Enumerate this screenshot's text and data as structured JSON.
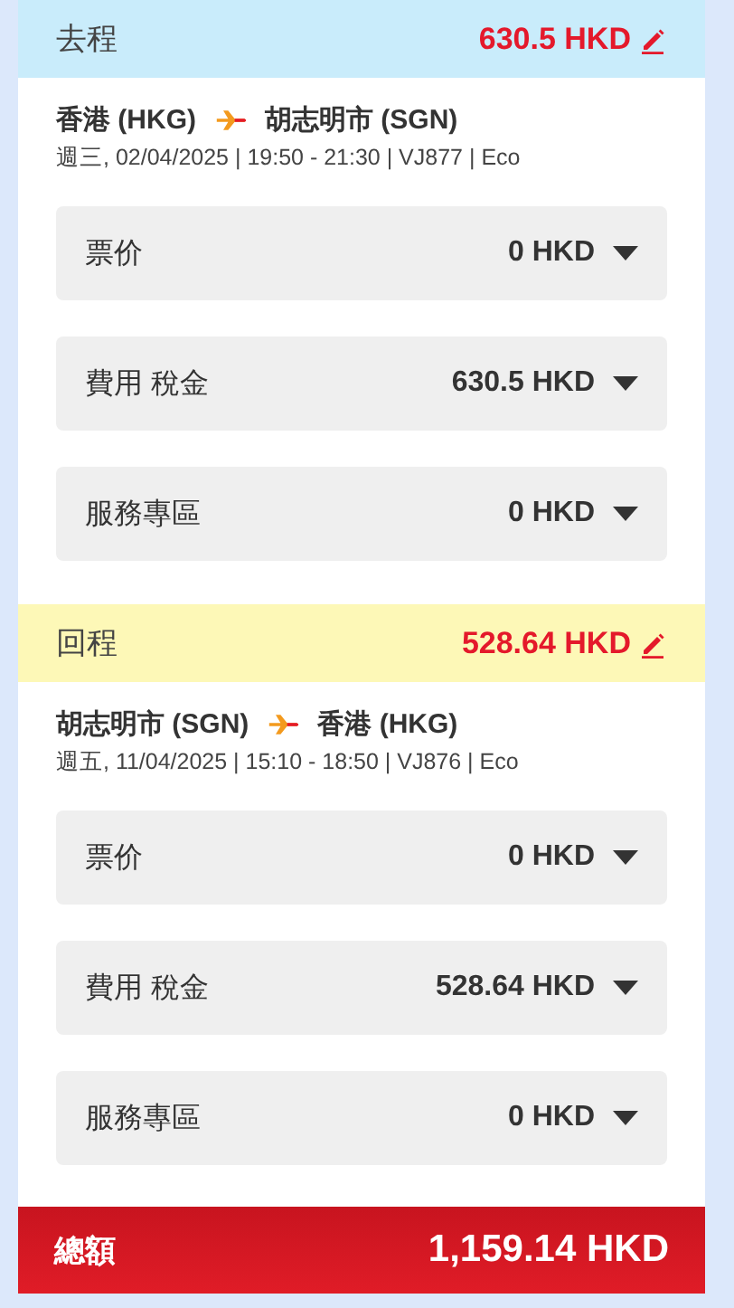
{
  "legs": [
    {
      "title": "去程",
      "color": "#c9ecfb",
      "amount": "630.5 HKD",
      "from": "香港 (HKG)",
      "to": "胡志明市 (SGN)",
      "details": "週三, 02/04/2025 | 19:50 - 21:30 | VJ877 | Eco",
      "fees": [
        {
          "label": "票价",
          "amount": "0 HKD",
          "expanded": false
        },
        {
          "label": "費用 稅金",
          "amount": "630.5 HKD",
          "expanded": false
        },
        {
          "label": "服務專區",
          "amount": "0 HKD",
          "expanded": false
        }
      ]
    },
    {
      "title": "回程",
      "color": "#fdf8b7",
      "amount": "528.64 HKD",
      "from": "胡志明市 (SGN)",
      "to": "香港 (HKG)",
      "details": "週五, 11/04/2025 | 15:10 - 18:50 | VJ876 | Eco",
      "fees": [
        {
          "label": "票价",
          "amount": "0 HKD",
          "expanded": false
        },
        {
          "label": "費用 稅金",
          "amount": "528.64 HKD",
          "expanded": false
        },
        {
          "label": "服務專區",
          "amount": "0 HKD",
          "expanded": false
        }
      ]
    }
  ],
  "total": {
    "label": "總額",
    "amount": "1,159.14 HKD"
  }
}
